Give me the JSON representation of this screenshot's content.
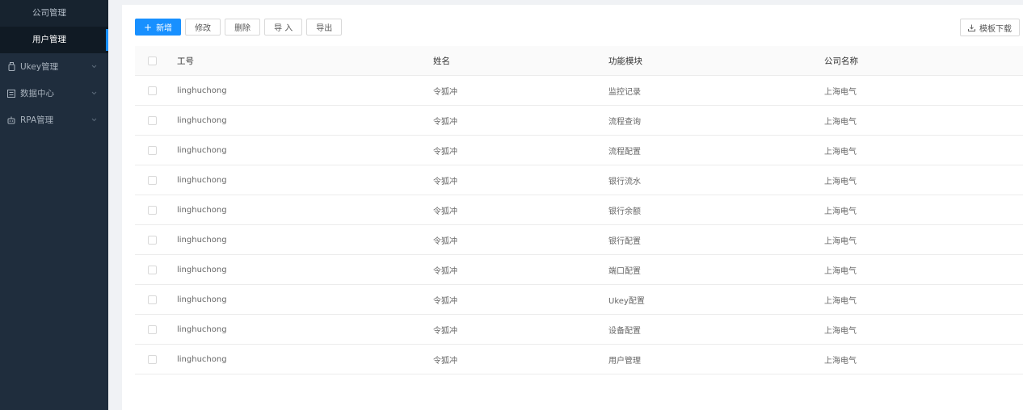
{
  "sidebar": {
    "sub_items": [
      {
        "label": "公司管理",
        "active": false
      },
      {
        "label": "用户管理",
        "active": true
      }
    ],
    "menus": [
      {
        "label": "Ukey管理",
        "icon": "usb-key-icon"
      },
      {
        "label": "数据中心",
        "icon": "data-center-icon"
      },
      {
        "label": "RPA管理",
        "icon": "robot-icon"
      }
    ]
  },
  "toolbar": {
    "add_label": "新增",
    "edit_label": "修改",
    "delete_label": "删除",
    "import_label": "导 入",
    "export_label": "导出",
    "template_label": "模板下载"
  },
  "table": {
    "columns": [
      "工号",
      "姓名",
      "功能模块",
      "公司名称"
    ],
    "rows": [
      [
        "linghuchong",
        "令狐冲",
        "监控记录",
        "上海电气"
      ],
      [
        "linghuchong",
        "令狐冲",
        "流程查询",
        "上海电气"
      ],
      [
        "linghuchong",
        "令狐冲",
        "流程配置",
        "上海电气"
      ],
      [
        "linghuchong",
        "令狐冲",
        "银行流水",
        "上海电气"
      ],
      [
        "linghuchong",
        "令狐冲",
        "银行余额",
        "上海电气"
      ],
      [
        "linghuchong",
        "令狐冲",
        "银行配置",
        "上海电气"
      ],
      [
        "linghuchong",
        "令狐冲",
        "端口配置",
        "上海电气"
      ],
      [
        "linghuchong",
        "令狐冲",
        "Ukey配置",
        "上海电气"
      ],
      [
        "linghuchong",
        "令狐冲",
        "设备配置",
        "上海电气"
      ],
      [
        "linghuchong",
        "令狐冲",
        "用户管理",
        "上海电气"
      ]
    ]
  },
  "colors": {
    "sidebar_bg": "#1f2d3d",
    "primary": "#1890ff"
  }
}
